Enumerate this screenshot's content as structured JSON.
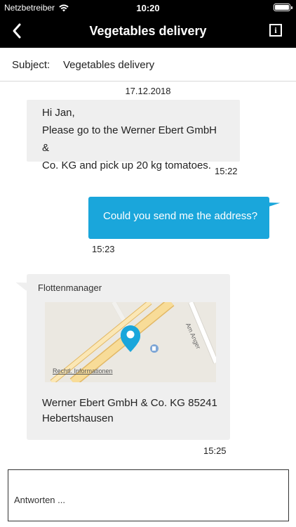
{
  "status": {
    "carrier": "Netzbetreiber",
    "time": "10:20"
  },
  "nav": {
    "title": "Vegetables delivery",
    "back_icon": "chevron-left-icon",
    "info_icon": "info-icon",
    "info_glyph": "i"
  },
  "subject": {
    "label": "Subject:",
    "value": "Vegetables delivery"
  },
  "chat": {
    "date": "17.12.2018",
    "messages": [
      {
        "direction": "incoming",
        "lines": [
          "Hi Jan,",
          "Please go to the Werner Ebert GmbH &",
          "Co. KG and pick up 20 kg tomatoes."
        ],
        "time": "15:22"
      },
      {
        "direction": "outgoing",
        "text": "Could you send me the address?",
        "time": "15:23"
      },
      {
        "direction": "incoming",
        "sender": "Flottenmanager",
        "map": {
          "street_label": "Am Anger",
          "legal_link": "Rechtl. Informationen"
        },
        "address_lines": [
          "Werner Ebert GmbH & Co. KG 85241",
          "Hebertshausen"
        ],
        "time": "15:25"
      }
    ]
  },
  "reply": {
    "placeholder": "Antworten ..."
  },
  "colors": {
    "header": "#000000",
    "outgoing_bubble": "#1aa6db",
    "incoming_bubble": "#efefef",
    "pin": "#1aa6db",
    "road": "#f5cf7c"
  }
}
